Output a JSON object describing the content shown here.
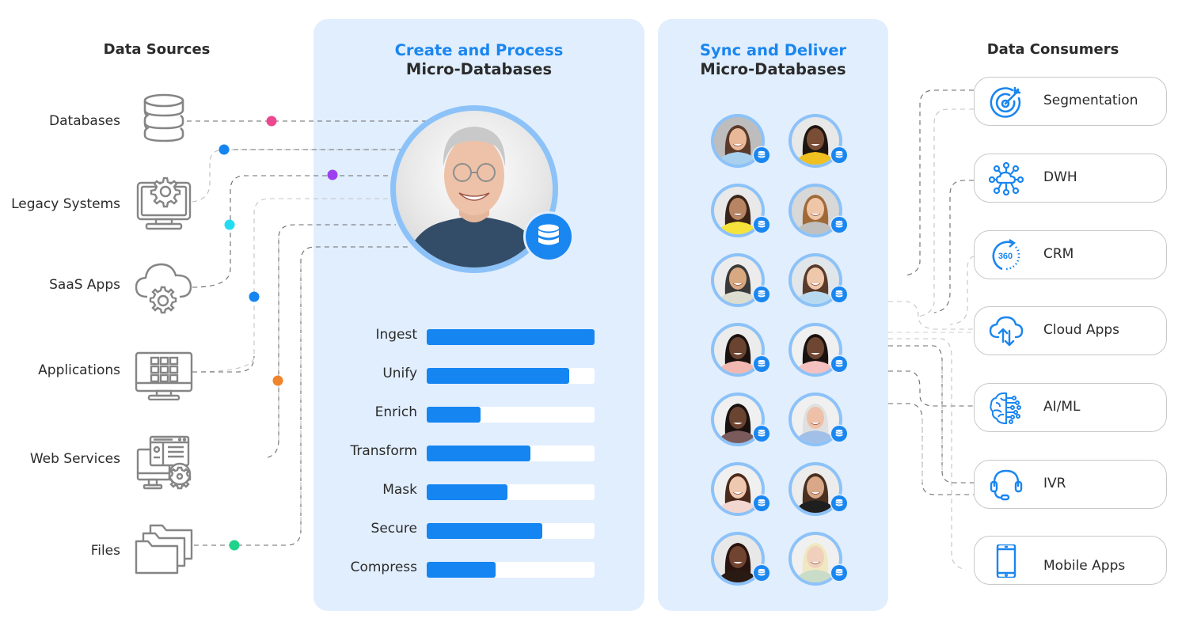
{
  "headings": {
    "sources": "Data Sources",
    "consumers": "Data Consumers"
  },
  "create_panel": {
    "title_accent": "Create and Process",
    "title_sub": "Micro-Databases",
    "hero_badge_icon": "database-icon",
    "process_steps": [
      {
        "label": "Ingest",
        "progress": 1.0
      },
      {
        "label": "Unify",
        "progress": 0.85
      },
      {
        "label": "Enrich",
        "progress": 0.32
      },
      {
        "label": "Transform",
        "progress": 0.62
      },
      {
        "label": "Mask",
        "progress": 0.48
      },
      {
        "label": "Secure",
        "progress": 0.69
      },
      {
        "label": "Compress",
        "progress": 0.41
      }
    ]
  },
  "sync_panel": {
    "title_accent": "Sync and Deliver",
    "title_sub": "Micro-Databases",
    "avatar_count": 14,
    "avatar_badge_icon": "database-icon"
  },
  "sources": [
    {
      "label": "Databases",
      "icon": "database-icon",
      "dot_color": "#ec4891"
    },
    {
      "label": "Legacy Systems",
      "icon": "monitor-gear-icon",
      "dot_color": "#1585f2"
    },
    {
      "label": "SaaS Apps",
      "icon": "cloud-gear-icon",
      "dot_color": "#22dcf2"
    },
    {
      "label": "Applications",
      "icon": "monitor-grid-icon",
      "dot_color": "#1585f2"
    },
    {
      "label": "Web Services",
      "icon": "web-services-icon",
      "dot_color": "#f0842c"
    },
    {
      "label": "Files",
      "icon": "folders-icon",
      "dot_color": "#1fd38a"
    }
  ],
  "extra_dot_color": "#9b3ff0",
  "consumers": [
    {
      "label": "Segmentation",
      "icon": "target-icon"
    },
    {
      "label": "DWH",
      "icon": "cloud-network-icon"
    },
    {
      "label": "CRM",
      "icon": "rotate-360-icon",
      "icon_text": "360"
    },
    {
      "label": "Cloud Apps",
      "icon": "cloud-sync-icon"
    },
    {
      "label": "AI/ML",
      "icon": "brain-circuit-icon"
    },
    {
      "label": "IVR",
      "icon": "headset-icon"
    },
    {
      "label": "Mobile Apps",
      "icon": "smartphone-icon"
    }
  ],
  "colors": {
    "accent": "#1a86ef",
    "panel_bg": "#e1eefe",
    "bar_fill": "#1585f2",
    "icon_gray": "#858585",
    "avatar_ring": "#8cc2f8"
  }
}
